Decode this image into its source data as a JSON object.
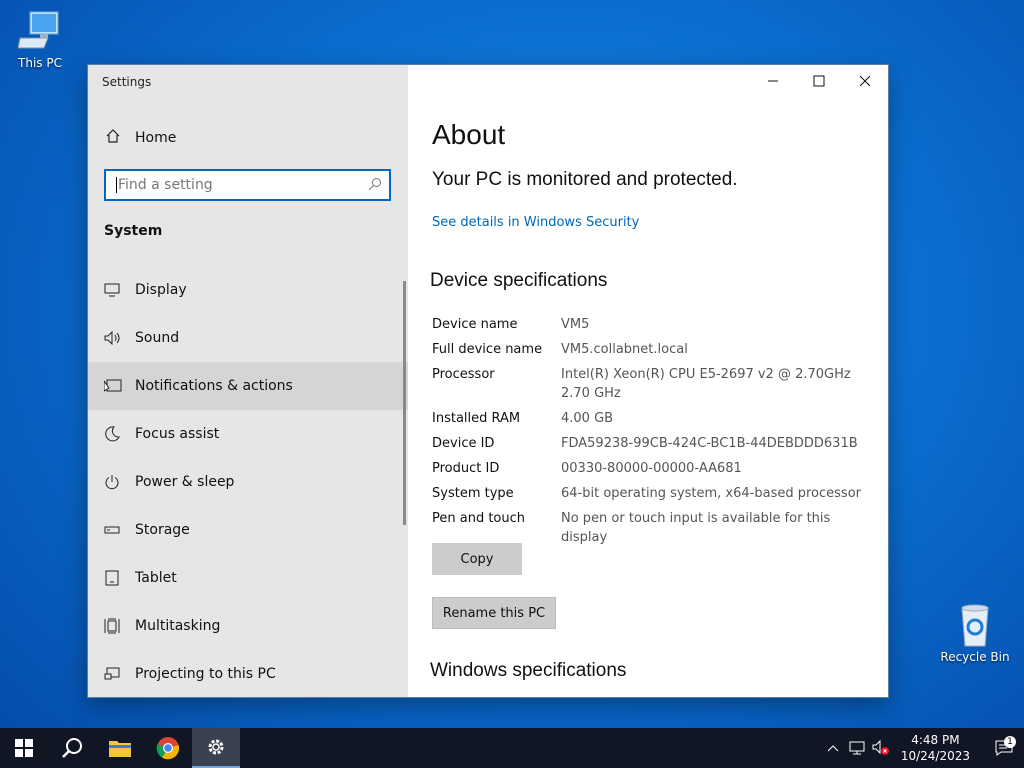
{
  "desktop": {
    "icons": [
      {
        "label": "This PC"
      },
      {
        "label": "Recycle Bin"
      }
    ]
  },
  "window": {
    "title": "Settings"
  },
  "sidebar": {
    "home_label": "Home",
    "search_placeholder": "Find a setting",
    "section": "System",
    "items": [
      {
        "label": "Display",
        "icon": "monitor-icon"
      },
      {
        "label": "Sound",
        "icon": "speaker-icon"
      },
      {
        "label": "Notifications & actions",
        "icon": "notification-icon"
      },
      {
        "label": "Focus assist",
        "icon": "moon-icon"
      },
      {
        "label": "Power & sleep",
        "icon": "power-icon"
      },
      {
        "label": "Storage",
        "icon": "storage-icon"
      },
      {
        "label": "Tablet",
        "icon": "tablet-icon"
      },
      {
        "label": "Multitasking",
        "icon": "multitasking-icon"
      },
      {
        "label": "Projecting to this PC",
        "icon": "projecting-icon"
      }
    ]
  },
  "content": {
    "title": "About",
    "protection_status": "Your PC is monitored and protected.",
    "security_link": "See details in Windows Security",
    "device_specs_heading": "Device specifications",
    "specs": [
      {
        "key": "Device name",
        "value": "VM5"
      },
      {
        "key": "Full device name",
        "value": "VM5.collabnet.local"
      },
      {
        "key": "Processor",
        "value": "Intel(R) Xeon(R) CPU E5-2697 v2 @ 2.70GHz   2.70 GHz"
      },
      {
        "key": "Installed RAM",
        "value": "4.00 GB"
      },
      {
        "key": "Device ID",
        "value": "FDA59238-99CB-424C-BC1B-44DEBDDD631B"
      },
      {
        "key": "Product ID",
        "value": "00330-80000-00000-AA681"
      },
      {
        "key": "System type",
        "value": "64-bit operating system, x64-based processor"
      },
      {
        "key": "Pen and touch",
        "value": "No pen or touch input is available for this display"
      }
    ],
    "copy_label": "Copy",
    "rename_label": "Rename this PC",
    "windows_specs_heading": "Windows specifications"
  },
  "taskbar": {
    "time": "4:48 PM",
    "date": "10/24/2023",
    "notification_count": "1"
  },
  "colors": {
    "accent": "#0067c0",
    "link": "#0067b8",
    "sidebar_bg": "#e6e6e6",
    "taskbar_bg": "#101623"
  }
}
